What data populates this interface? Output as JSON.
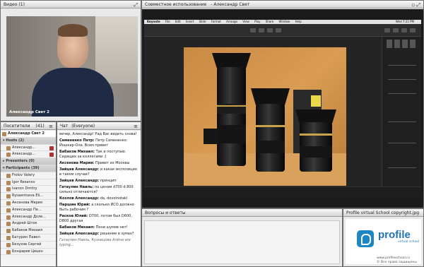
{
  "video": {
    "title": "Видео",
    "count": "(1)",
    "presenter_name": "Александр Свет 2"
  },
  "share": {
    "title": "Совместное использование",
    "subtitle": "- Александр Свет",
    "menubar": [
      "Keynote",
      "File",
      "Edit",
      "Insert",
      "Slide",
      "Format",
      "Arrange",
      "View",
      "Play",
      "Share",
      "Window",
      "Help"
    ],
    "clock": "Wed 7:21 PM"
  },
  "attendees": {
    "title": "Посетители",
    "count": "(41)",
    "me": "Александр Свет 2",
    "groups": [
      {
        "label": "Hosts (2)",
        "rows": [
          "Александр...",
          "Александр..."
        ]
      },
      {
        "label": "Presenters (0)",
        "rows": []
      },
      {
        "label": "Participants (39)",
        "rows": [
          "Frolov Valery",
          "Igor Resanov",
          "Ivanon Dmitry",
          "Rysaentseva Eli...",
          "Аксенова Мария",
          "Александр Пе...",
          "Александр Доле...",
          "Андрей Шток",
          "Бабаков Михаил",
          "Батурин Павел",
          "Безухов Сергей",
          "Бондарев Цецен"
        ]
      }
    ]
  },
  "chat": {
    "title": "Чат",
    "scope": "(Everyone)",
    "messages": [
      {
        "text": "вечер, Александр! Рад Вас видеть снова!"
      },
      {
        "author": "Семененко Петр:",
        "text": "Петр Семененко: Йошкар-Ола. Всем привет"
      },
      {
        "author": "Бабаков Михаил:",
        "text": "Так и поступаю. Сидящих за коллегами :)"
      },
      {
        "author": "Аксенова Мария:",
        "text": "Привет из Москвы"
      },
      {
        "author": "Зайцев Александр:",
        "text": "и какая экспозиция в таком случае?"
      },
      {
        "author": "Зайцев Александр:",
        "text": "принцип"
      },
      {
        "author": "Гатаулин Наиль:",
        "text": "по ценам d700 d 800 сильно отличаются?"
      },
      {
        "author": "Козлов Александр:",
        "text": "da, dovolnotaki"
      },
      {
        "author": "Паршин Юрий:",
        "text": "а сколько ИСО должно быть рабочим ?"
      },
      {
        "author": "Расков Юлий:",
        "text": "D700, потом был D600, D800 другая"
      },
      {
        "author": "Бабаков Михаил:",
        "text": "Пони шумов нет!"
      },
      {
        "author": "Зайцев Александр:",
        "text": "решение в зумах?"
      }
    ],
    "typing": "Гатаулин Наиль, Кузнецова Алёна are typing..."
  },
  "qa": {
    "title": "Вопросы и ответы"
  },
  "logo_pod": {
    "title": "Profile virtual School copyright.jpg",
    "word": "profile",
    "sub": "virtual school",
    "site": "www.profileschool.ru",
    "rights": "© Все права защищены"
  },
  "icons": {
    "fullscreen": "fullscreen-icon",
    "menu": "pod-menu-icon",
    "user": "user-icon"
  },
  "colors": {
    "pod_header_top": "#fafafa",
    "pod_header_bottom": "#d4d4d4",
    "logo_blue": "#1d86c4"
  }
}
